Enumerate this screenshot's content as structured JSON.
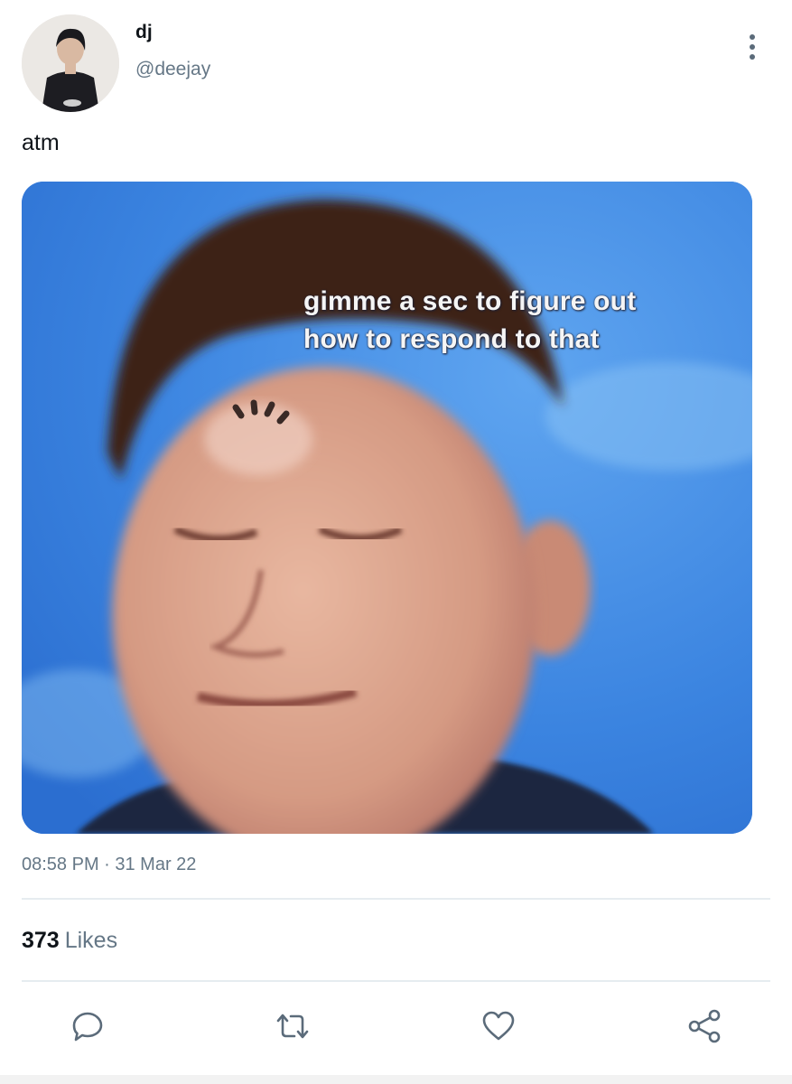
{
  "user": {
    "display_name": "dj",
    "handle": "@deejay",
    "avatar_icon": "avatar-photo"
  },
  "tweet": {
    "text": "atm",
    "media": {
      "caption_line1": "gimme a sec to figure out",
      "caption_line2": "how to respond to that"
    },
    "timestamp": "08:58 PM · 31 Mar 22",
    "likes_count": "373",
    "likes_label": "Likes"
  },
  "actions": [
    "reply-icon",
    "retweet-icon",
    "like-icon",
    "share-icon"
  ],
  "colors": {
    "text": "#0f1419",
    "muted": "#657786",
    "divider": "#e6ecf0",
    "media_bg": "#3b84e0"
  }
}
